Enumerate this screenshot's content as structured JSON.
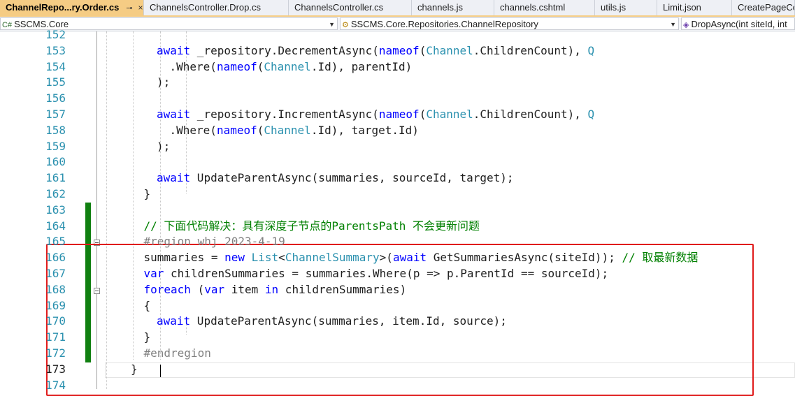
{
  "tabs": [
    {
      "label": "ChannelRepo...ry.Order.cs",
      "active": true
    },
    {
      "label": "ChannelsController.Drop.cs"
    },
    {
      "label": "ChannelsController.cs"
    },
    {
      "label": "channels.js"
    },
    {
      "label": "channels.cshtml"
    },
    {
      "label": "utils.js"
    },
    {
      "label": "Limit.json"
    },
    {
      "label": "CreatePageCo"
    }
  ],
  "tab_pin_glyph": "⊸",
  "tab_close_glyph": "×",
  "navbar": {
    "project": "SSCMS.Core",
    "type": "SSCMS.Core.Repositories.ChannelRepository",
    "member": "DropAsync(int siteId, int"
  },
  "colors": {
    "keyword": "#0000ff",
    "type": "#2b91af",
    "comment": "#008000",
    "region": "#808080",
    "highlight_box": "#e01b1b",
    "change_bar": "#108010",
    "active_tab": "#f5cc84"
  },
  "lines": [
    {
      "n": "152",
      "parts": []
    },
    {
      "n": "153",
      "indent": 8,
      "parts": [
        [
          "kw",
          "await"
        ],
        [
          "t",
          " _repository.DecrementAsync("
        ],
        [
          "kw",
          "nameof"
        ],
        [
          "t",
          "("
        ],
        [
          "ty",
          "Channel"
        ],
        [
          "t",
          ".ChildrenCount), "
        ],
        [
          "ty",
          "Q"
        ]
      ]
    },
    {
      "n": "154",
      "indent": 10,
      "parts": [
        [
          "t",
          ".Where("
        ],
        [
          "kw",
          "nameof"
        ],
        [
          "t",
          "("
        ],
        [
          "ty",
          "Channel"
        ],
        [
          "t",
          ".Id), parentId)"
        ]
      ]
    },
    {
      "n": "155",
      "indent": 8,
      "parts": [
        [
          "t",
          ");"
        ]
      ]
    },
    {
      "n": "156",
      "parts": []
    },
    {
      "n": "157",
      "indent": 8,
      "parts": [
        [
          "kw",
          "await"
        ],
        [
          "t",
          " _repository.IncrementAsync("
        ],
        [
          "kw",
          "nameof"
        ],
        [
          "t",
          "("
        ],
        [
          "ty",
          "Channel"
        ],
        [
          "t",
          ".ChildrenCount), "
        ],
        [
          "ty",
          "Q"
        ]
      ]
    },
    {
      "n": "158",
      "indent": 10,
      "parts": [
        [
          "t",
          ".Where("
        ],
        [
          "kw",
          "nameof"
        ],
        [
          "t",
          "("
        ],
        [
          "ty",
          "Channel"
        ],
        [
          "t",
          ".Id), target.Id)"
        ]
      ]
    },
    {
      "n": "159",
      "indent": 8,
      "parts": [
        [
          "t",
          ");"
        ]
      ]
    },
    {
      "n": "160",
      "parts": []
    },
    {
      "n": "161",
      "indent": 8,
      "parts": [
        [
          "kw",
          "await"
        ],
        [
          "t",
          " UpdateParentAsync(summaries, sourceId, target);"
        ]
      ]
    },
    {
      "n": "162",
      "indent": 6,
      "parts": [
        [
          "t",
          "}"
        ]
      ]
    },
    {
      "n": "163",
      "parts": []
    },
    {
      "n": "164",
      "indent": 6,
      "parts": [
        [
          "cm",
          "// 下面代码解决：具有深度子节点的ParentsPath 不会更新问题"
        ]
      ]
    },
    {
      "n": "165",
      "indent": 6,
      "parts": [
        [
          "rg",
          "#region whj 2023-4-19"
        ]
      ]
    },
    {
      "n": "166",
      "indent": 6,
      "parts": [
        [
          "t",
          "summaries = "
        ],
        [
          "kw",
          "new"
        ],
        [
          "t",
          " "
        ],
        [
          "ty",
          "List"
        ],
        [
          "t",
          "<"
        ],
        [
          "ty",
          "ChannelSummary"
        ],
        [
          "t",
          ">("
        ],
        [
          "kw",
          "await"
        ],
        [
          "t",
          " GetSummariesAsync(siteId)); "
        ],
        [
          "cm",
          "// 取最新数据"
        ]
      ]
    },
    {
      "n": "167",
      "indent": 6,
      "parts": [
        [
          "kw",
          "var"
        ],
        [
          "t",
          " childrenSummaries = summaries.Where(p => p.ParentId == sourceId);"
        ]
      ]
    },
    {
      "n": "168",
      "indent": 6,
      "parts": [
        [
          "kw",
          "foreach"
        ],
        [
          "t",
          " ("
        ],
        [
          "kw",
          "var"
        ],
        [
          "t",
          " item "
        ],
        [
          "kw",
          "in"
        ],
        [
          "t",
          " childrenSummaries)"
        ]
      ]
    },
    {
      "n": "169",
      "indent": 6,
      "parts": [
        [
          "t",
          "{"
        ]
      ]
    },
    {
      "n": "170",
      "indent": 8,
      "parts": [
        [
          "kw",
          "await"
        ],
        [
          "t",
          " UpdateParentAsync(summaries, item.Id, source);"
        ]
      ]
    },
    {
      "n": "171",
      "indent": 6,
      "parts": [
        [
          "t",
          "}"
        ]
      ]
    },
    {
      "n": "172",
      "indent": 6,
      "parts": [
        [
          "rg",
          "#endregion"
        ]
      ]
    },
    {
      "n": "173",
      "current": true,
      "indent": 4,
      "parts": [
        [
          "t",
          "}"
        ]
      ]
    },
    {
      "n": "174",
      "parts": []
    }
  ]
}
